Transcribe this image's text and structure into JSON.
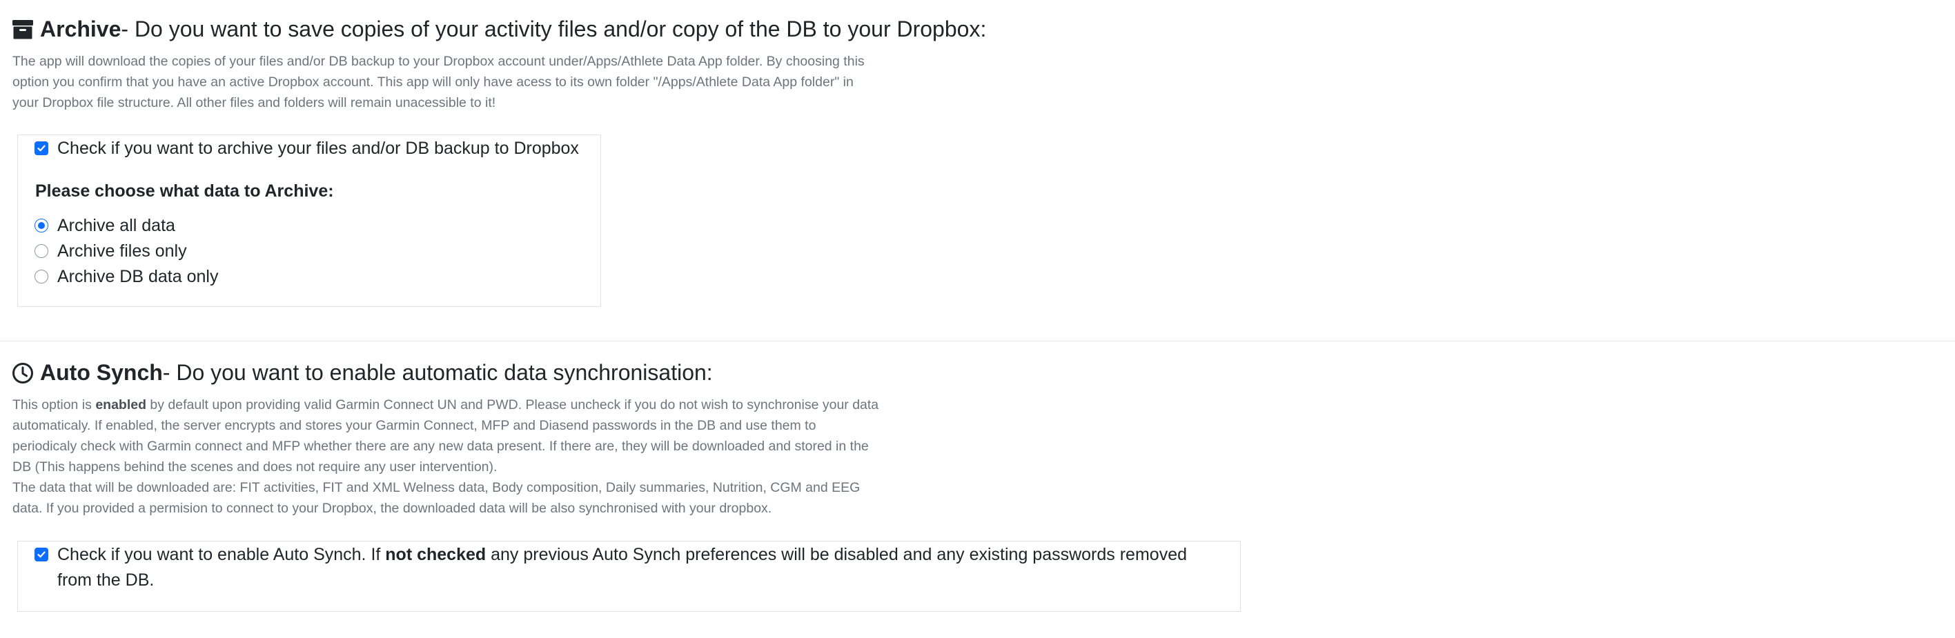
{
  "archive": {
    "icon": "archive-icon",
    "title_strong": "Archive",
    "title_rest": " - Do you want to save copies of your activity files and/or copy of the DB to your Dropbox:",
    "description": "The app will download the copies of your files and/or DB backup to your Dropbox account under/Apps/Athlete Data App folder. By choosing this option you confirm that you have an active Dropbox account. This app will only have acess to its own folder \"/Apps/Athlete Data App folder\" in your Dropbox file structure. All other files and folders will remain unacessible to it!",
    "checkbox_label": "Check if you want to archive your files and/or DB backup to Dropbox",
    "checkbox_checked": true,
    "choose_label": "Please choose what data to Archive:",
    "options": [
      {
        "label": "Archive all data",
        "checked": true
      },
      {
        "label": "Archive files only",
        "checked": false
      },
      {
        "label": "Archive DB data only",
        "checked": false
      }
    ]
  },
  "autosynch": {
    "icon": "clock-icon",
    "title_strong": "Auto Synch",
    "title_rest": " - Do you want to enable automatic data synchronisation:",
    "desc_p1_before": "This option is ",
    "desc_p1_bold": "enabled",
    "desc_p1_after": " by default upon providing valid Garmin Connect UN and PWD. Please uncheck if you do not wish to synchronise your data automaticaly. If enabled, the server encrypts and stores your Garmin Connect, MFP and Diasend passwords in the DB and use them to periodicaly check with Garmin connect and MFP whether there are any new data present. If there are, they will be downloaded and stored in the DB (This happens behind the scenes and does not require any user intervention).",
    "desc_p2": "The data that will be downloaded are: FIT activities, FIT and XML Welness data, Body composition, Daily summaries, Nutrition, CGM and EEG data. If you provided a permision to connect to your Dropbox, the downloaded data will be also synchronised with your dropbox.",
    "checkbox_before": "Check if you want to enable Auto Synch. If ",
    "checkbox_bold": "not checked",
    "checkbox_after": " any previous Auto Synch preferences will be disabled and any existing passwords removed from the DB.",
    "checkbox_checked": true
  }
}
